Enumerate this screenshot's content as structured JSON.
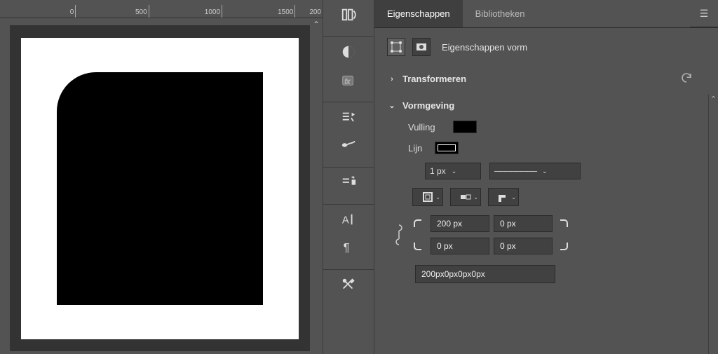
{
  "ruler": {
    "t0": "0",
    "t1": "500",
    "t2": "1000",
    "t3": "1500",
    "t4": "200"
  },
  "tabs": {
    "properties": "Eigenschappen",
    "libraries": "Bibliotheken"
  },
  "header": {
    "title": "Eigenschappen vorm"
  },
  "sections": {
    "transform": {
      "title": "Transformeren"
    },
    "appearance": {
      "title": "Vormgeving"
    }
  },
  "appearance": {
    "fill_label": "Vulling",
    "stroke_label": "Lijn",
    "stroke_width": "1 px",
    "stroke_style": "────────",
    "corners": {
      "tl": "200 px",
      "tr": "0 px",
      "bl": "0 px",
      "br": "0 px",
      "summary": "200px0px0px0px"
    }
  },
  "chart_data": null
}
